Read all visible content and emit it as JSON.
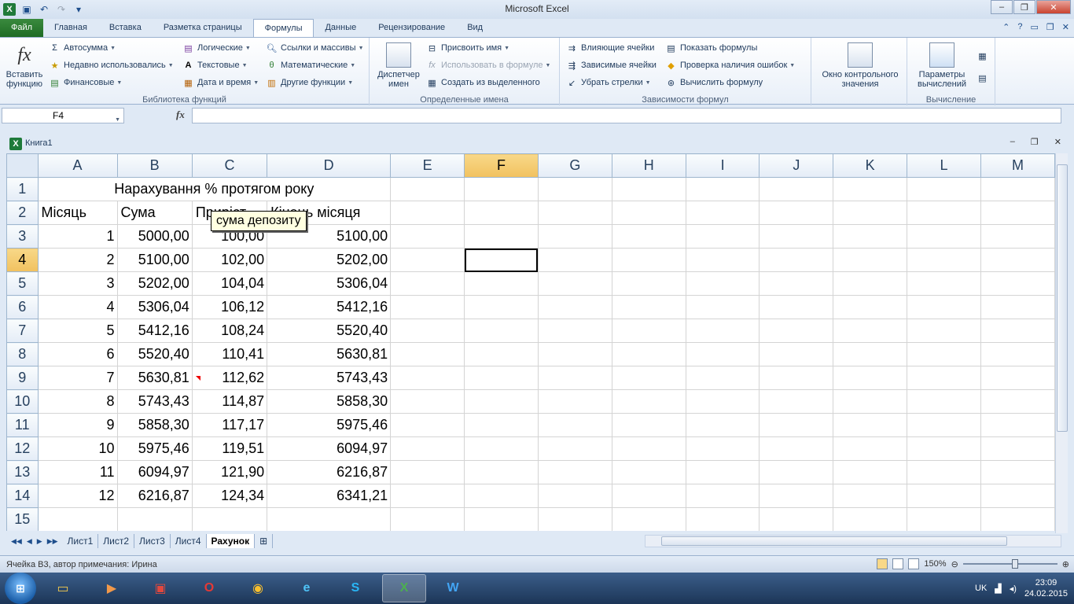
{
  "window": {
    "title": "Microsoft Excel",
    "min_label": "–",
    "max_label": "❐",
    "close_label": "✕"
  },
  "ribbon_tabs": [
    {
      "label": "Файл"
    },
    {
      "label": "Главная"
    },
    {
      "label": "Вставка"
    },
    {
      "label": "Разметка страницы"
    },
    {
      "label": "Формулы"
    },
    {
      "label": "Данные"
    },
    {
      "label": "Рецензирование"
    },
    {
      "label": "Вид"
    }
  ],
  "ribbon": {
    "insert_function_line1": "Вставить",
    "insert_function_line2": "функцию",
    "autosum": "Автосумма",
    "recent": "Недавно использовались",
    "financial": "Финансовые",
    "logical": "Логические",
    "text": "Текстовые",
    "datetime": "Дата и время",
    "lookup": "Ссылки и массивы",
    "math": "Математические",
    "more": "Другие функции",
    "group_library": "Библиотека функций",
    "name_manager_line1": "Диспетчер",
    "name_manager_line2": "имен",
    "define_name": "Присвоить имя",
    "use_in_formula": "Использовать в формуле",
    "create_from_selection": "Создать из выделенного",
    "group_names": "Определенные имена",
    "trace_precedents": "Влияющие ячейки",
    "trace_dependents": "Зависимые ячейки",
    "remove_arrows": "Убрать стрелки",
    "show_formulas": "Показать формулы",
    "error_checking": "Проверка наличия ошибок",
    "evaluate_formula": "Вычислить формулу",
    "watch_window_line1": "Окно контрольного",
    "watch_window_line2": "значения",
    "group_auditing": "Зависимости формул",
    "calc_options_line1": "Параметры",
    "calc_options_line2": "вычислений",
    "group_calculation": "Вычисление"
  },
  "formula_bar": {
    "name_box": "F4",
    "fx": "fx",
    "formula": ""
  },
  "workbook": {
    "name": "Книга1"
  },
  "sheet": {
    "columns": [
      "A",
      "B",
      "C",
      "D",
      "E",
      "F",
      "G",
      "H",
      "I",
      "J",
      "K",
      "L",
      "M"
    ],
    "selected_column": "F",
    "selected_row": 4,
    "title": "Нарахування % протягом року",
    "headers": [
      "Місяць",
      "Сума",
      "Приріст",
      "Кінець місяця"
    ],
    "rows": [
      [
        "1",
        "5000,00",
        "100,00",
        "5100,00"
      ],
      [
        "2",
        "5100,00",
        "102,00",
        "5202,00"
      ],
      [
        "3",
        "5202,00",
        "104,04",
        "5306,04"
      ],
      [
        "4",
        "5306,04",
        "106,12",
        "5412,16"
      ],
      [
        "5",
        "5412,16",
        "108,24",
        "5520,40"
      ],
      [
        "6",
        "5520,40",
        "110,41",
        "5630,81"
      ],
      [
        "7",
        "5630,81",
        "112,62",
        "5743,43"
      ],
      [
        "8",
        "5743,43",
        "114,87",
        "5858,30"
      ],
      [
        "9",
        "5858,30",
        "117,17",
        "5975,46"
      ],
      [
        "10",
        "5975,46",
        "119,51",
        "6094,97"
      ],
      [
        "11",
        "6094,97",
        "121,90",
        "6216,87"
      ],
      [
        "12",
        "6216,87",
        "124,34",
        "6341,21"
      ]
    ],
    "comment": "сума депозиту"
  },
  "sheet_tabs": [
    {
      "label": "Лист1"
    },
    {
      "label": "Лист2"
    },
    {
      "label": "Лист3"
    },
    {
      "label": "Лист4"
    },
    {
      "label": "Рахунок",
      "active": true
    }
  ],
  "status": {
    "text": "Ячейка B3, автор примечания: Ирина",
    "zoom": "150%"
  },
  "taskbar": {
    "language": "UK",
    "time": "23:09",
    "date": "24.02.2015"
  }
}
